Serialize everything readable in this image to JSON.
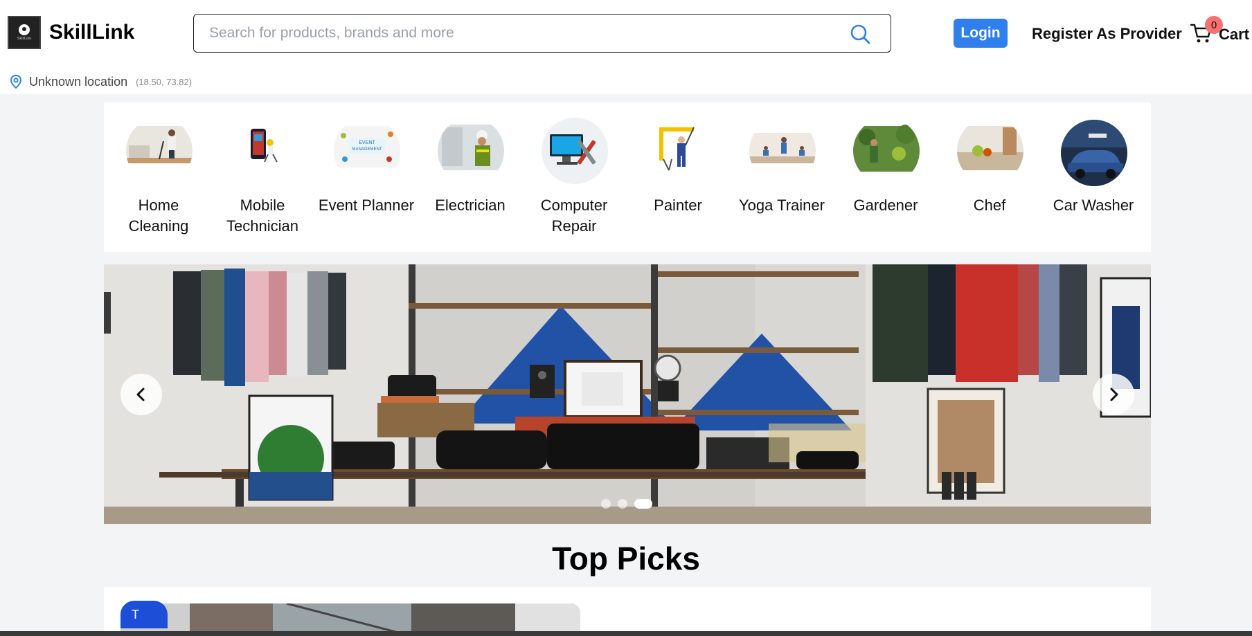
{
  "brand": {
    "name": "SkillLink",
    "logo_small_text": "SkillLink"
  },
  "search": {
    "placeholder": "Search for products, brands and more",
    "value": ""
  },
  "header": {
    "login_label": "Login",
    "register_label": "Register As Provider",
    "cart_label": "Cart",
    "cart_count": "0"
  },
  "location": {
    "name": "Unknown location",
    "coords": "(18.50, 73.82)"
  },
  "categories": [
    {
      "label": "Home Cleaning",
      "icon": "home-cleaning-photo"
    },
    {
      "label": "Mobile Technician",
      "icon": "mobile-technician-photo"
    },
    {
      "label": "Event Planner",
      "icon": "event-planner-photo"
    },
    {
      "label": "Electrician",
      "icon": "electrician-photo"
    },
    {
      "label": "Computer Repair",
      "icon": "computer-repair-photo"
    },
    {
      "label": "Painter",
      "icon": "painter-photo"
    },
    {
      "label": "Yoga Trainer",
      "icon": "yoga-trainer-photo"
    },
    {
      "label": "Gardener",
      "icon": "gardener-photo"
    },
    {
      "label": "Chef",
      "icon": "chef-photo"
    },
    {
      "label": "Car Washer",
      "icon": "car-washer-photo"
    }
  ],
  "banner": {
    "slides": 3,
    "active_slide": 3
  },
  "top_picks": {
    "title": "Top Picks",
    "first_tag": "T"
  },
  "colors": {
    "accent": "#2f80ed",
    "badge": "#f87171",
    "page_bg": "#f3f4f6"
  }
}
